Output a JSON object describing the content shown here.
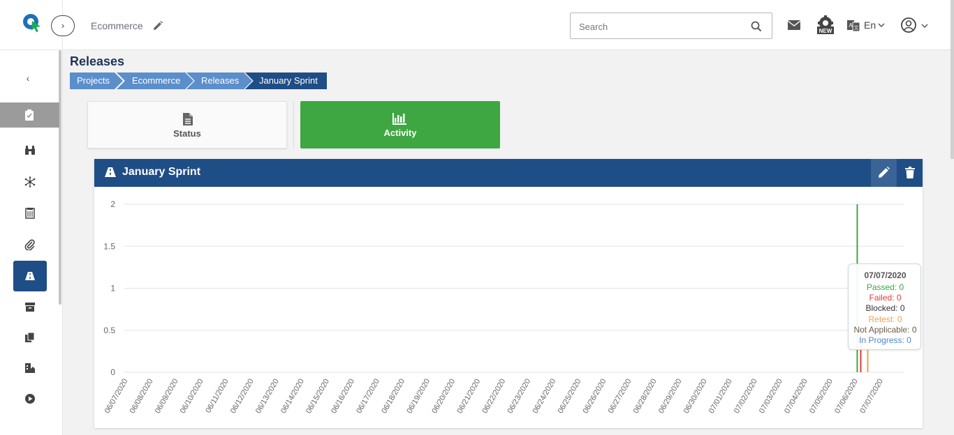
{
  "header": {
    "project_name": "Ecommerce",
    "search_placeholder": "Search",
    "language": "En"
  },
  "page": {
    "title": "Releases",
    "breadcrumb": [
      "Projects",
      "Ecommerce",
      "Releases",
      "January Sprint"
    ]
  },
  "tabs": [
    {
      "label": "Status",
      "icon": "document-icon"
    },
    {
      "label": "Activity",
      "icon": "bar-chart-icon",
      "active": true
    }
  ],
  "panel": {
    "title": "January Sprint",
    "icon": "road-icon"
  },
  "colors": {
    "primary": "#1f4d85",
    "active_tab": "#3ea742",
    "passed": "#3ea742",
    "failed": "#e53935",
    "blocked": "#333333",
    "retest": "#f0a050",
    "not_applicable": "#6d5c4a",
    "in_progress": "#4a86d4"
  },
  "chart_data": {
    "type": "line",
    "ylim": [
      0,
      2
    ],
    "yticks": [
      "0",
      "0.5",
      "1",
      "1.5",
      "2"
    ],
    "x": [
      "06/07/2020",
      "06/08/2020",
      "06/09/2020",
      "06/10/2020",
      "06/11/2020",
      "06/12/2020",
      "06/13/2020",
      "06/14/2020",
      "06/15/2020",
      "06/16/2020",
      "06/17/2020",
      "06/18/2020",
      "06/19/2020",
      "06/20/2020",
      "06/21/2020",
      "06/22/2020",
      "06/23/2020",
      "06/24/2020",
      "06/25/2020",
      "06/26/2020",
      "06/27/2020",
      "06/28/2020",
      "06/29/2020",
      "06/30/2020",
      "07/01/2020",
      "07/02/2020",
      "07/03/2020",
      "07/04/2020",
      "07/05/2020",
      "07/06/2020",
      "07/07/2020"
    ],
    "series": [
      {
        "name": "Passed",
        "color": "#3ea742",
        "values": [
          0,
          0,
          0,
          0,
          0,
          0,
          0,
          0,
          0,
          0,
          0,
          0,
          0,
          0,
          0,
          0,
          0,
          0,
          0,
          0,
          0,
          0,
          0,
          0,
          0,
          0,
          0,
          0,
          0,
          2,
          0
        ]
      },
      {
        "name": "Failed",
        "color": "#e53935",
        "values": [
          0,
          0,
          0,
          0,
          0,
          0,
          0,
          0,
          0,
          0,
          0,
          0,
          0,
          0,
          0,
          0,
          0,
          0,
          0,
          0,
          0,
          0,
          0,
          0,
          0,
          0,
          0,
          0,
          0,
          0.5,
          0
        ]
      },
      {
        "name": "Blocked",
        "color": "#333333",
        "values": [
          0,
          0,
          0,
          0,
          0,
          0,
          0,
          0,
          0,
          0,
          0,
          0,
          0,
          0,
          0,
          0,
          0,
          0,
          0,
          0,
          0,
          0,
          0,
          0,
          0,
          0,
          0,
          0,
          0,
          0,
          0
        ]
      },
      {
        "name": "Retest",
        "color": "#f0a050",
        "values": [
          0,
          0,
          0,
          0,
          0,
          0,
          0,
          0,
          0,
          0,
          0,
          0,
          0,
          0,
          0,
          0,
          0,
          0,
          0,
          0,
          0,
          0,
          0,
          0,
          0,
          0,
          0,
          0,
          0,
          0.5,
          0
        ]
      },
      {
        "name": "Not Applicable",
        "color": "#6d5c4a",
        "values": [
          0,
          0,
          0,
          0,
          0,
          0,
          0,
          0,
          0,
          0,
          0,
          0,
          0,
          0,
          0,
          0,
          0,
          0,
          0,
          0,
          0,
          0,
          0,
          0,
          0,
          0,
          0,
          0,
          0,
          0,
          0
        ]
      },
      {
        "name": "In Progress",
        "color": "#4a86d4",
        "values": [
          0,
          0,
          0,
          0,
          0,
          0,
          0,
          0,
          0,
          0,
          0,
          0,
          0,
          0,
          0,
          0,
          0,
          0,
          0,
          0,
          0,
          0,
          0,
          0,
          0,
          0,
          0,
          0,
          0,
          0,
          0
        ]
      }
    ],
    "grid": true,
    "tooltip": {
      "date": "07/07/2020",
      "passed": "Passed: 0",
      "failed": "Failed: 0",
      "blocked": "Blocked: 0",
      "retest": "Retest: 0",
      "not_applicable": "Not Applicable: 0",
      "in_progress": "In Progress: 0"
    }
  }
}
